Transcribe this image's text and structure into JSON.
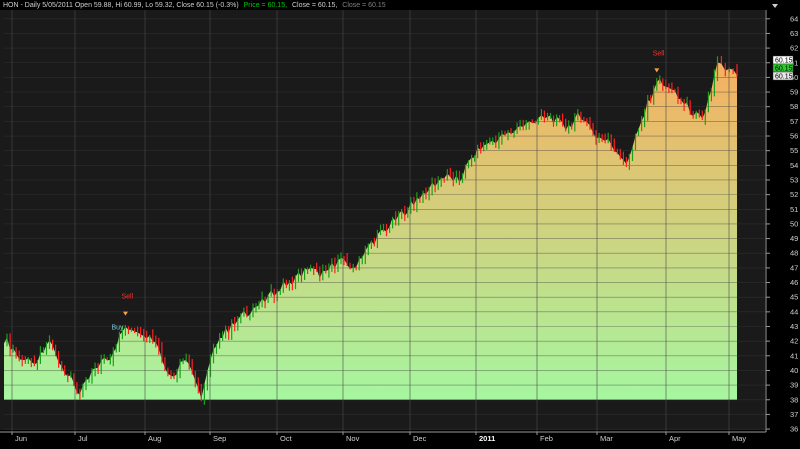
{
  "header": {
    "symbol_info": "HON - Daily 5/05/2011 Open 59.88, Hi 60.99, Lo 59.32, Close 60.15 (-0.3%)",
    "price_legend": "Price = 60.15,",
    "close_legend_1": "Close = 60.15,",
    "close_legend_2": "Close = 60.15"
  },
  "price_tags": [
    "60.15",
    "60.15",
    "60.15"
  ],
  "colors": {
    "background": "#000000",
    "chart_bg": "#1c1c1c",
    "up_candle": "#1aa01a",
    "down_candle": "#ff2020",
    "fill_top": "#f6b060",
    "fill_bottom": "#a6f6a0",
    "legend_green": "#00c800",
    "legend_grey": "#808080",
    "sell_marker": "#ffa040"
  },
  "chart_data": {
    "type": "area",
    "title": "HON - Daily 5/05/2011 Open 59.88, Hi 60.99, Lo 59.32, Close 60.15 (-0.3%)",
    "series": [
      {
        "name": "Price",
        "color": "#00c800"
      },
      {
        "name": "Close",
        "color": "#cfcfcf"
      },
      {
        "name": "Close",
        "color": "#808080"
      }
    ],
    "x_ticks": [
      {
        "label": "Jun",
        "bold": false
      },
      {
        "label": "Jul",
        "bold": false
      },
      {
        "label": "Aug",
        "bold": false
      },
      {
        "label": "Sep",
        "bold": false
      },
      {
        "label": "Oct",
        "bold": false
      },
      {
        "label": "Nov",
        "bold": false
      },
      {
        "label": "Dec",
        "bold": false
      },
      {
        "label": "2011",
        "bold": true
      },
      {
        "label": "Feb",
        "bold": false
      },
      {
        "label": "Mar",
        "bold": false
      },
      {
        "label": "Apr",
        "bold": false
      },
      {
        "label": "May",
        "bold": false
      }
    ],
    "y_ticks": [
      36,
      37,
      38,
      39,
      40,
      41,
      42,
      43,
      44,
      45,
      46,
      47,
      48,
      49,
      50,
      51,
      52,
      53,
      54,
      55,
      56,
      57,
      58,
      59,
      60,
      61,
      62,
      63,
      64
    ],
    "ylim": [
      35.8,
      64.6
    ],
    "fill_baseline": 38,
    "x": [
      "2010-06-01",
      "2010-06-08",
      "2010-06-15",
      "2010-06-22",
      "2010-06-29",
      "2010-07-06",
      "2010-07-13",
      "2010-07-20",
      "2010-07-27",
      "2010-08-03",
      "2010-08-10",
      "2010-08-17",
      "2010-08-24",
      "2010-08-31",
      "2010-09-07",
      "2010-09-14",
      "2010-09-21",
      "2010-09-28",
      "2010-10-05",
      "2010-10-12",
      "2010-10-19",
      "2010-10-26",
      "2010-11-02",
      "2010-11-09",
      "2010-11-16",
      "2010-11-23",
      "2010-11-30",
      "2010-12-07",
      "2010-12-14",
      "2010-12-21",
      "2010-12-28",
      "2011-01-04",
      "2011-01-11",
      "2011-01-18",
      "2011-01-25",
      "2011-02-01",
      "2011-02-08",
      "2011-02-15",
      "2011-02-22",
      "2011-03-01",
      "2011-03-08",
      "2011-03-15",
      "2011-03-22",
      "2011-03-29",
      "2011-04-05",
      "2011-04-12",
      "2011-04-19",
      "2011-04-26",
      "2011-05-05"
    ],
    "close": [
      42.2,
      41.0,
      40.2,
      42.0,
      40.0,
      38.3,
      40.2,
      41.0,
      43.0,
      42.8,
      42.0,
      39.5,
      41.0,
      38.3,
      42.0,
      43.0,
      44.0,
      44.6,
      45.5,
      46.2,
      46.9,
      46.5,
      47.5,
      47.0,
      48.5,
      49.5,
      50.5,
      51.5,
      52.5,
      53.2,
      53.0,
      54.8,
      55.6,
      56.0,
      56.6,
      57.0,
      57.3,
      56.5,
      57.5,
      56.0,
      55.5,
      54.2,
      57.0,
      59.8,
      59.0,
      58.0,
      57.0,
      60.8,
      60.15
    ],
    "annotations": [
      {
        "label": "Sell",
        "date": "2010-07-27",
        "price": 43.4
      },
      {
        "label": "Buy",
        "date": "2010-07-27",
        "price": 43.0
      },
      {
        "label": "Sell",
        "date": "2011-03-29",
        "price": 60.0
      }
    ],
    "grid": true,
    "legend": "top-left"
  }
}
